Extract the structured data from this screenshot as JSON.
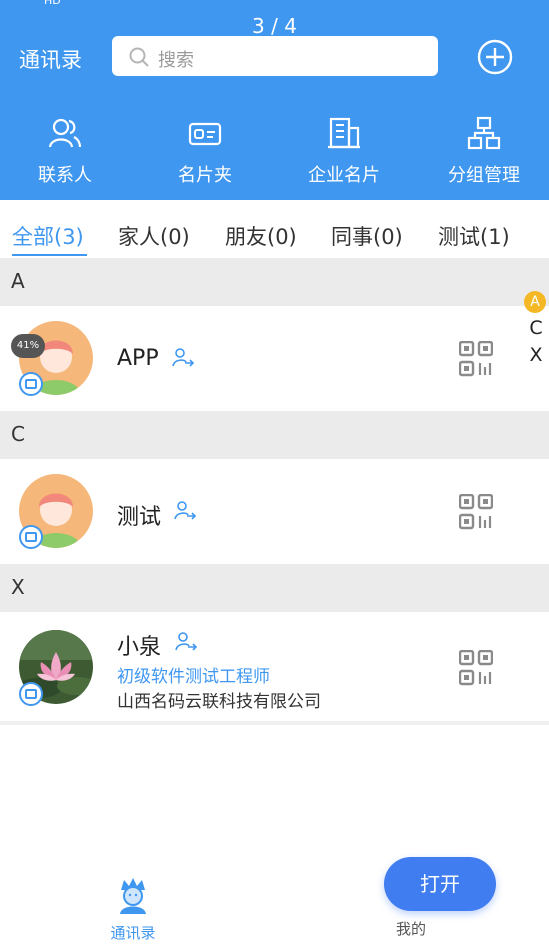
{
  "status_bar": {
    "left_text": "HD"
  },
  "page_indicator": "3 / 4",
  "header": {
    "title": "通讯录",
    "search_placeholder": "搜索",
    "add_icon": "plus-circle-icon"
  },
  "nav": [
    {
      "label": "联系人",
      "icon": "contacts-icon"
    },
    {
      "label": "名片夹",
      "icon": "card-holder-icon"
    },
    {
      "label": "企业名片",
      "icon": "building-icon"
    },
    {
      "label": "分组管理",
      "icon": "org-tree-icon"
    }
  ],
  "tabs": [
    {
      "label": "全部(3)",
      "active": true
    },
    {
      "label": "家人(0)"
    },
    {
      "label": "朋友(0)"
    },
    {
      "label": "同事(0)"
    },
    {
      "label": "测试(1)"
    }
  ],
  "sections": [
    {
      "letter": "A",
      "contacts": [
        {
          "name": "APP",
          "progress_badge": "41%"
        }
      ]
    },
    {
      "letter": "C",
      "contacts": [
        {
          "name": "测试"
        }
      ]
    },
    {
      "letter": "X",
      "contacts": [
        {
          "name": "小泉",
          "title": "初级软件测试工程师",
          "company": "山西名码云联科技有限公司"
        }
      ]
    }
  ],
  "alpha_index": [
    "A",
    "C",
    "X"
  ],
  "bottom_nav": [
    {
      "label": "通讯录",
      "active": true
    },
    {
      "label": "我的"
    }
  ],
  "open_button": "打开",
  "colors": {
    "primary": "#3f97f0",
    "index_highlight": "#f5b825",
    "section_bg": "#ebebeb"
  }
}
